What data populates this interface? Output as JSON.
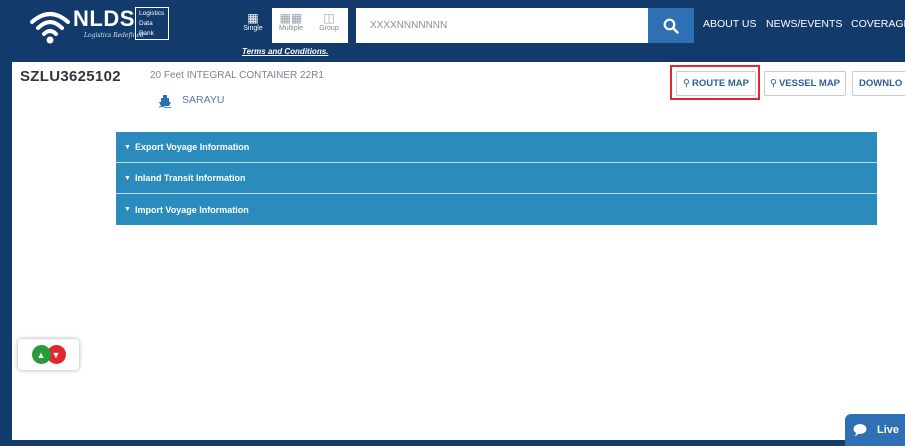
{
  "header": {
    "logo_text": "NLDS",
    "logo_tagline": "Logistics Redefined",
    "logo_box_lines": [
      "Logistics",
      "Data",
      "Bank"
    ],
    "modes": [
      {
        "label": "Single",
        "icon": "single-container-icon",
        "active": true
      },
      {
        "label": "Multiple",
        "icon": "multiple-containers-icon",
        "active": false
      },
      {
        "label": "Group",
        "icon": "group-containers-icon",
        "active": false
      }
    ],
    "terms_link": "Terms and Conditions.",
    "search_value": "XXXXNNNNNNN",
    "search_icon": "search-icon",
    "nav": [
      "ABOUT US",
      "NEWS/EVENTS",
      "COVERAGE"
    ]
  },
  "container": {
    "id": "SZLU3625102",
    "type": "20 Feet INTEGRAL CONTAINER 22R1",
    "vessel": "SARAYU"
  },
  "actions": {
    "route_map": "ROUTE MAP",
    "vessel_map": "VESSEL MAP",
    "download": "DOWNLO"
  },
  "sections": [
    {
      "label": "Export Voyage Information"
    },
    {
      "label": "Inland Transit Information"
    },
    {
      "label": "Import Voyage Information"
    }
  ],
  "chat": {
    "label": "Live"
  },
  "colors": {
    "header_bg": "#123a6b",
    "accent": "#2f6fb4",
    "section_bg": "#2b8bbd",
    "highlight": "#e0282e",
    "like": "#2a9b3a",
    "dislike": "#e0282e"
  }
}
